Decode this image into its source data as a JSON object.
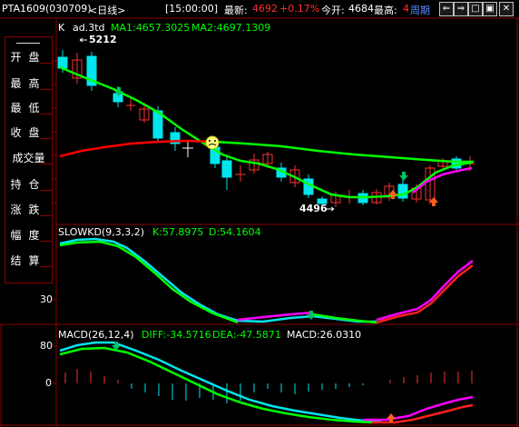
{
  "topbar": {
    "symbol": "PTA1609",
    "code": "(030709)",
    "period": "<日线>",
    "time": "[15:00:00]",
    "latest_label": "最新:",
    "latest_value": "4692",
    "change_pct": "+0.17%",
    "open_interest_label": "今开:",
    "open_interest_value": "4684",
    "high_label": "最高:",
    "high_value": "4",
    "cycle_label": "周期"
  },
  "sidepanel": {
    "items": [
      "开盘",
      "最高",
      "最低",
      "收盘",
      "成交量",
      "持仓",
      "涨跌",
      "幅度",
      "结算"
    ]
  },
  "kline": {
    "header_k": "K",
    "header_name": "ad.3td",
    "ma1_label": "MA1:4657.3025",
    "ma2_label": "MA2:4697.1309",
    "high_annotation": "5212",
    "low_annotation": "4496"
  },
  "kd": {
    "header_name": "SLOWKD(9,3,3,2)",
    "k_label": "K:57.8975",
    "d_label": "D:54.1604",
    "tick_30": "30"
  },
  "macd": {
    "header_name": "MACD(26,12,4)",
    "diff_label": "DIFF:-34.5716",
    "dea_label": "DEA:-47.5871",
    "macd_label": "MACD:26.0310",
    "tick_80": "80",
    "tick_0": "0"
  },
  "colors": {
    "up_candle": "#ff3030",
    "down_candle": "#00e5ee",
    "ma1": "#00ff00",
    "ma2": "#ff0000",
    "k_line": "#00e5ee",
    "d_line": "#00ff00",
    "magenta": "#ff00ff",
    "border": "#8a0000"
  }
}
